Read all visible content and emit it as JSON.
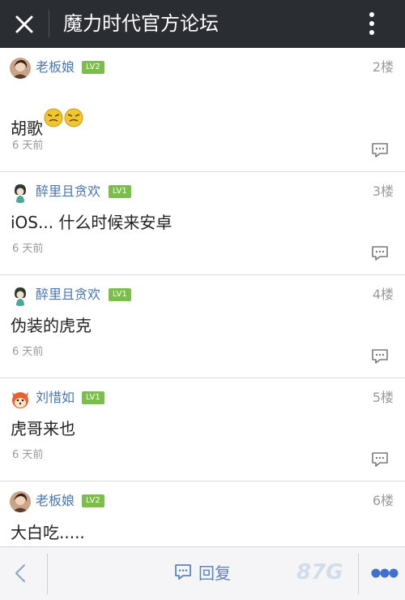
{
  "app": {
    "title": "魔力时代官方论坛"
  },
  "posts": [
    {
      "user": "老板娘",
      "level": "LV2",
      "floor": "2楼",
      "content": "胡歌",
      "time": "6 天前"
    },
    {
      "user": "醉里且贪欢",
      "level": "LV1",
      "floor": "3楼",
      "content": "iOS... 什么时候来安卓",
      "time": "6 天前"
    },
    {
      "user": "醉里且贪欢",
      "level": "LV1",
      "floor": "4楼",
      "content": "伪装的虎克",
      "time": "6 天前"
    },
    {
      "user": "刘惜如",
      "level": "LV1",
      "floor": "5楼",
      "content": "虎哥来也",
      "time": "6 天前"
    },
    {
      "user": "老板娘",
      "level": "LV2",
      "floor": "6楼",
      "content": "大白吃.....",
      "time": ""
    }
  ],
  "bottombar": {
    "reply_label": "回复"
  },
  "watermark": "87G",
  "colors": {
    "topbar": "#2a2d32",
    "username": "#4a77b0",
    "level_badge": "#7bbf4a",
    "reply": "#5a84c2"
  }
}
